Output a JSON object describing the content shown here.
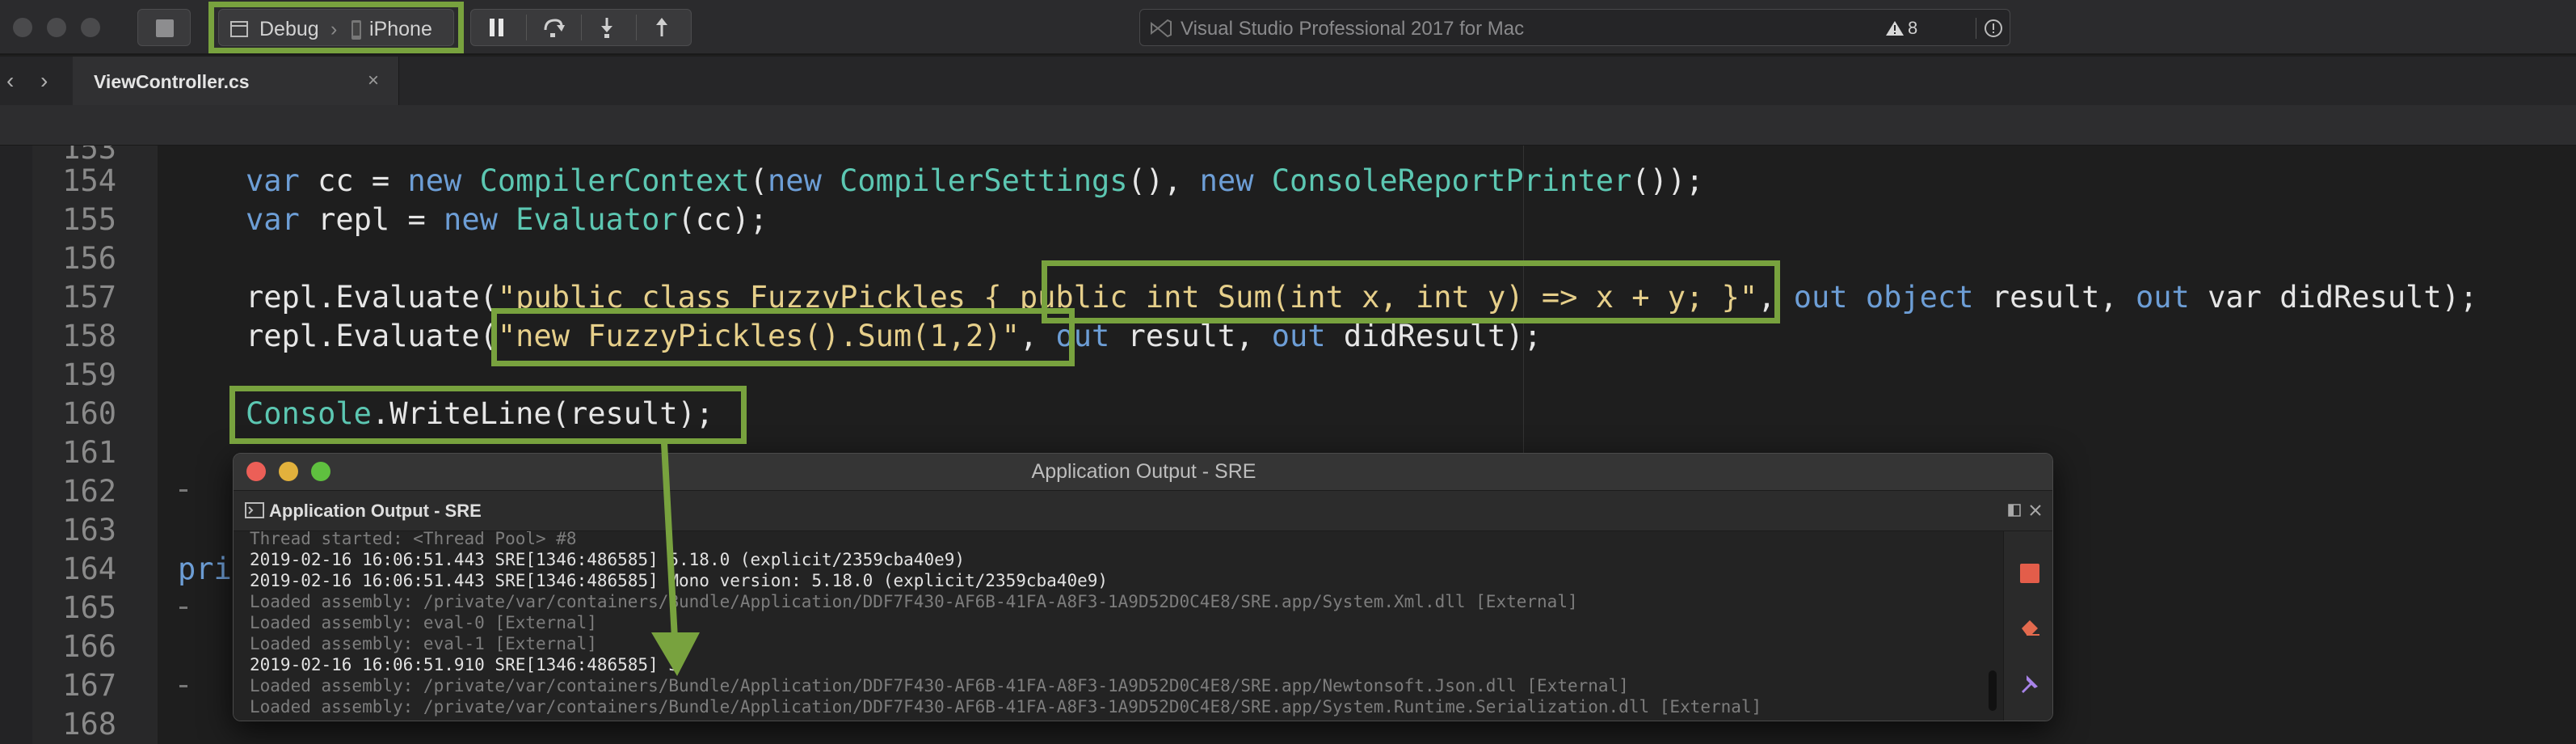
{
  "toolbar": {
    "configuration": "Debug",
    "separator": "›",
    "device": "iPhone",
    "status_title": "Visual Studio Professional 2017 for Mac",
    "warning_count": "8"
  },
  "tabs": {
    "back": "‹",
    "forward": "›",
    "active_label": "ViewController.cs",
    "close": "×"
  },
  "editor": {
    "line_numbers": [
      "153",
      "154",
      "155",
      "156",
      "157",
      "158",
      "159",
      "160",
      "161",
      "162",
      "163",
      "164",
      "165",
      "166",
      "167",
      "168"
    ],
    "partial_text": "priv",
    "l154": {
      "k1": "var",
      "t1": " cc = ",
      "k2": "new",
      "sp": " ",
      "ty1": "CompilerContext",
      "t2": "(",
      "k3": "new",
      "sp2": " ",
      "ty2": "CompilerSettings",
      "t3": "(), ",
      "k4": "new",
      "sp3": " ",
      "ty3": "ConsoleReportPrinter",
      "t4": "());"
    },
    "l155": {
      "k1": "var",
      "t1": " repl = ",
      "k2": "new",
      "sp": " ",
      "ty1": "Evaluator",
      "t2": "(cc);"
    },
    "l157": {
      "t1": "repl.Evaluate(",
      "s1": "\"public class FuzzyPickles { public int Sum(int x, int y) => x + y; }\"",
      "t2": ", ",
      "k1": "out",
      "sp": " ",
      "k2": "object",
      "t3": " result, ",
      "k3": "out",
      "t4": " var didResult);"
    },
    "l158": {
      "t1": "repl.Evaluate(",
      "s1": "\"new FuzzyPickles().Sum(1,2)\"",
      "t2": ", ",
      "k1": "out",
      "t3": " result, ",
      "k2": "out",
      "t4": " didResult);"
    },
    "l160": {
      "ty1": "Console",
      "t1": ".WriteLine(result);"
    }
  },
  "output_window": {
    "title": "Application Output - SRE",
    "pad_label": "Application Output - SRE",
    "lines": [
      {
        "text": "Thread started: <Thread Pool> #8",
        "style": "dim"
      },
      {
        "text": "2019-02-16 16:06:51.443 SRE[1346:486585] 5.18.0 (explicit/2359cba40e9)",
        "style": "bright"
      },
      {
        "text": "2019-02-16 16:06:51.443 SRE[1346:486585] Mono version: 5.18.0 (explicit/2359cba40e9)",
        "style": "bright"
      },
      {
        "text": "Loaded assembly: /private/var/containers/Bundle/Application/DDF7F430-AF6B-41FA-A8F3-1A9D52D0C4E8/SRE.app/System.Xml.dll [External]",
        "style": "dim"
      },
      {
        "text": "Loaded assembly: eval-0 [External]",
        "style": "dim"
      },
      {
        "text": "Loaded assembly: eval-1 [External]",
        "style": "dim"
      },
      {
        "text": "2019-02-16 16:06:51.910 SRE[1346:486585] 3",
        "style": "bright"
      },
      {
        "text": "Loaded assembly: /private/var/containers/Bundle/Application/DDF7F430-AF6B-41FA-A8F3-1A9D52D0C4E8/SRE.app/Newtonsoft.Json.dll [External]",
        "style": "dim"
      },
      {
        "text": "Loaded assembly: /private/var/containers/Bundle/Application/DDF7F430-AF6B-41FA-A8F3-1A9D52D0C4E8/SRE.app/System.Runtime.Serialization.dll [External]",
        "style": "dim"
      }
    ]
  },
  "colors": {
    "highlight": "#78a23e",
    "keyword": "#6d9ed6",
    "type": "#5cc7b2",
    "string": "#e6cf8a"
  },
  "icons": [
    "stop-icon",
    "window-icon",
    "phone-icon",
    "pause-icon",
    "step-over-icon",
    "step-into-icon",
    "step-out-icon",
    "vs-logo-icon",
    "warning-icon",
    "info-icon",
    "terminal-icon",
    "clear-icon",
    "pin-icon",
    "expand-icon",
    "close-icon"
  ]
}
